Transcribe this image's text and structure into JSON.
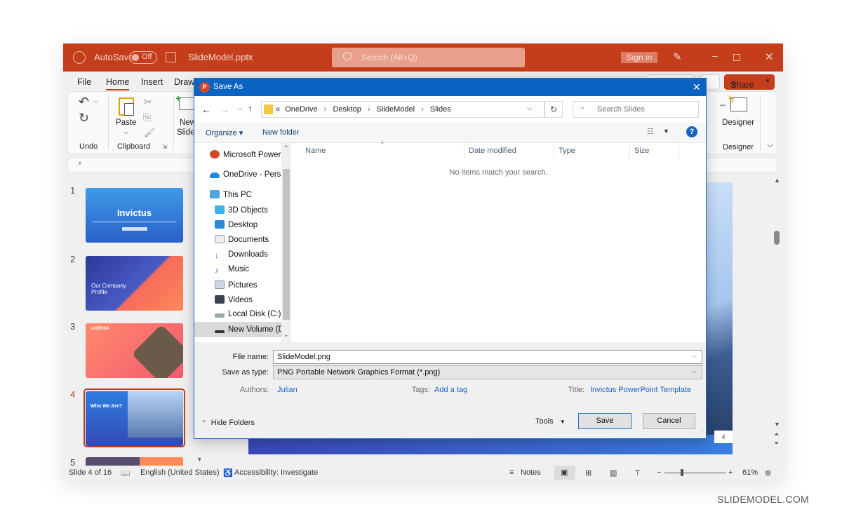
{
  "app": {
    "autosave_label": "AutoSave",
    "autosave_state": "Off",
    "file_name": "SlideModel.pptx",
    "search_placeholder": "Search (Alt+Q)",
    "signin_label": "Sign in",
    "accent": "#c43e1c",
    "tabs": [
      "File",
      "Home",
      "Insert",
      "Draw"
    ],
    "share_label": "Share",
    "ribbon": {
      "undo_group": "Undo",
      "paste_label": "Paste",
      "clipboard_group": "Clipboard",
      "new_slide_label_1": "New",
      "new_slide_label_2": "Slide",
      "designer_label": "Designer",
      "designer_group": "Designer"
    },
    "slides": [
      {
        "num": "1",
        "title": "Invictus",
        "subtitle": "PRESENTATION TEMPLATE"
      },
      {
        "num": "2",
        "title": "Our Company Profile"
      },
      {
        "num": "3",
        "title": "AGENDA"
      },
      {
        "num": "4",
        "title": "Who We Are?",
        "selected": true
      },
      {
        "num": "5",
        "title": ""
      }
    ],
    "slide_page_number": "4",
    "status": {
      "slide_info": "Slide 4 of 16",
      "language": "English (United States)",
      "accessibility": "Accessibility: Investigate",
      "notes": "Notes",
      "zoom": "61%",
      "zoom_value_percent": 61
    }
  },
  "dialog": {
    "title": "Save As",
    "breadcrumb": [
      "«",
      "OneDrive",
      "Desktop",
      "SlideModel",
      "Slides"
    ],
    "search_placeholder": "Search Slides",
    "organize_label": "Organize",
    "new_folder_label": "New folder",
    "tree": [
      {
        "label": "Microsoft PowerP",
        "icon": "powerpoint-icon",
        "indent": 0
      },
      {
        "label": "OneDrive - Persor",
        "icon": "onedrive-icon",
        "indent": 0
      },
      {
        "label": "This PC",
        "icon": "pc-icon",
        "indent": 0
      },
      {
        "label": "3D Objects",
        "icon": "3d-objects-icon",
        "indent": 1
      },
      {
        "label": "Desktop",
        "icon": "desktop-icon",
        "indent": 1
      },
      {
        "label": "Documents",
        "icon": "documents-icon",
        "indent": 1
      },
      {
        "label": "Downloads",
        "icon": "downloads-icon",
        "indent": 1
      },
      {
        "label": "Music",
        "icon": "music-icon",
        "indent": 1
      },
      {
        "label": "Pictures",
        "icon": "pictures-icon",
        "indent": 1
      },
      {
        "label": "Videos",
        "icon": "videos-icon",
        "indent": 1
      },
      {
        "label": "Local Disk (C:)",
        "icon": "drive-icon",
        "indent": 1
      },
      {
        "label": "New Volume (D:",
        "icon": "drive-icon",
        "indent": 1,
        "selected": true
      }
    ],
    "columns": [
      "Name",
      "Date modified",
      "Type",
      "Size"
    ],
    "empty_message": "No items match your search.",
    "file_name_label": "File name:",
    "file_name_value": "SlideModel.png",
    "save_type_label": "Save as type:",
    "save_type_value": "PNG Portable Network Graphics Format (*.png)",
    "authors_label": "Authors:",
    "authors_value": "Julian",
    "tags_label": "Tags:",
    "tags_value": "Add a tag",
    "title_label": "Title:",
    "title_value": "Invictus PowerPoint Template",
    "hide_folders_label": "Hide Folders",
    "tools_label": "Tools",
    "save_label": "Save",
    "cancel_label": "Cancel"
  },
  "watermark": "SLIDEMODEL.COM"
}
